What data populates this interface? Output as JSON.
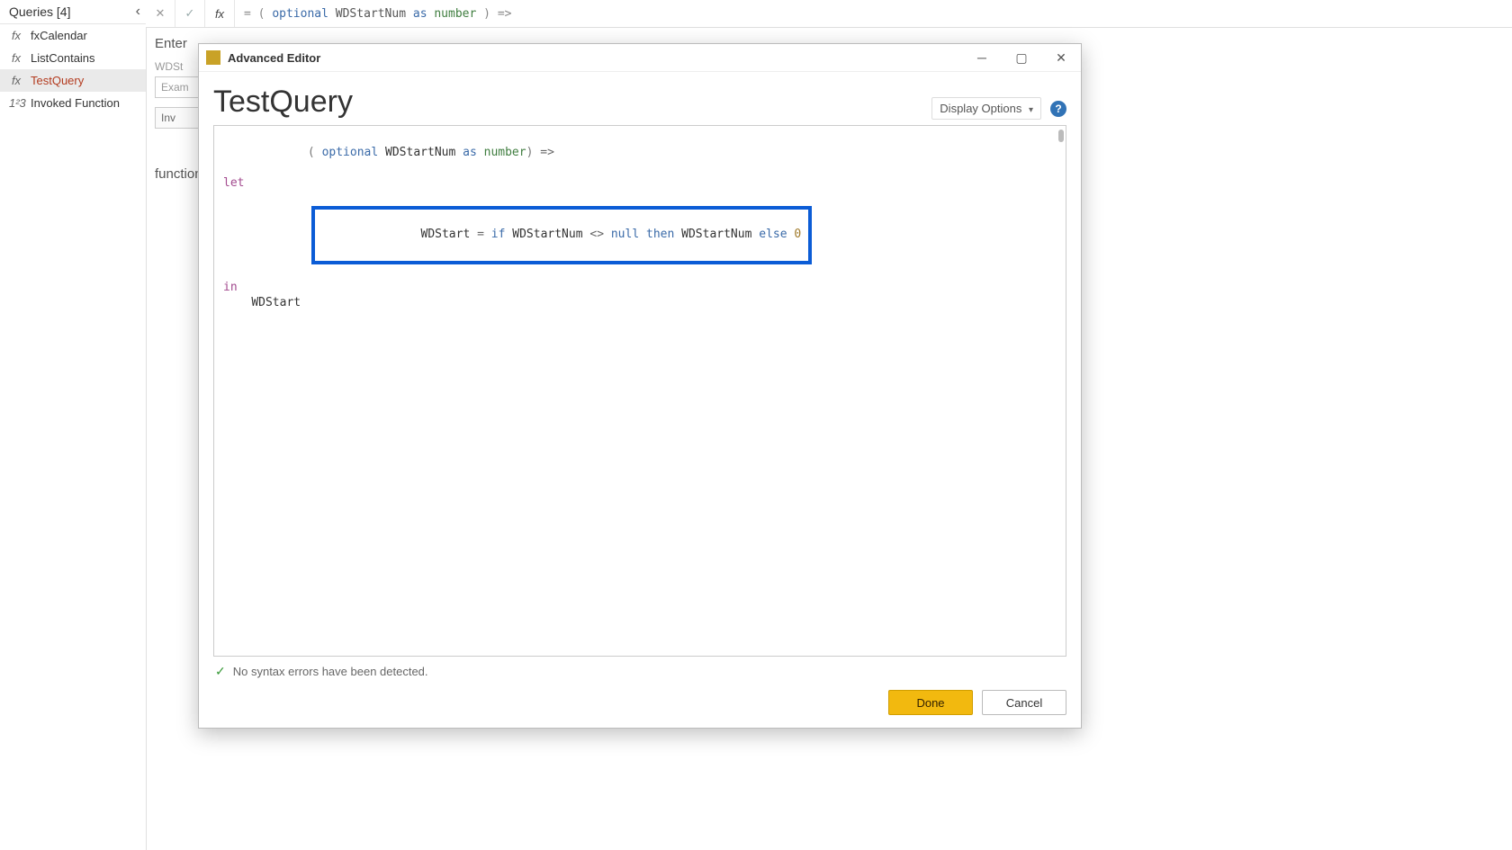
{
  "sidebar": {
    "title": "Queries [4]",
    "items": [
      {
        "icon": "fx",
        "label": "fxCalendar"
      },
      {
        "icon": "fx",
        "label": "ListContains"
      },
      {
        "icon": "fx",
        "label": "TestQuery",
        "selected": true
      },
      {
        "icon": "1²3",
        "label": "Invoked Function"
      }
    ]
  },
  "formula_bar": {
    "raw": "= ( optional WDStartNum as number) =>",
    "tokens": {
      "eq": "=",
      "lp": "(",
      "optional": "optional",
      "param": "WDStartNum",
      "as": "as",
      "type": "number",
      "rp": ")",
      "arrow": "=>"
    }
  },
  "background": {
    "enter_label": "Enter",
    "param_label": "WDSt",
    "example_placeholder": "Exam",
    "invoke_btn": "Inv",
    "function_label": "function"
  },
  "modal": {
    "title": "Advanced Editor",
    "query_name": "TestQuery",
    "display_options_label": "Display Options",
    "help_symbol": "?",
    "code": {
      "line1": {
        "lp": "(",
        "optional": "optional",
        "param": "WDStartNum",
        "as": "as",
        "type": "number",
        "rp": ")",
        "arrow": "=>"
      },
      "line2_let": "let",
      "line3": {
        "var": "WDStart",
        "eq": "=",
        "if": "if",
        "param": "WDStartNum",
        "neq": "<>",
        "null": "null",
        "then": "then",
        "param2": "WDStartNum",
        "else": "else",
        "zero": "0"
      },
      "line4_in": "in",
      "line5_var": "WDStart"
    },
    "status_text": "No syntax errors have been detected.",
    "done_label": "Done",
    "cancel_label": "Cancel"
  }
}
